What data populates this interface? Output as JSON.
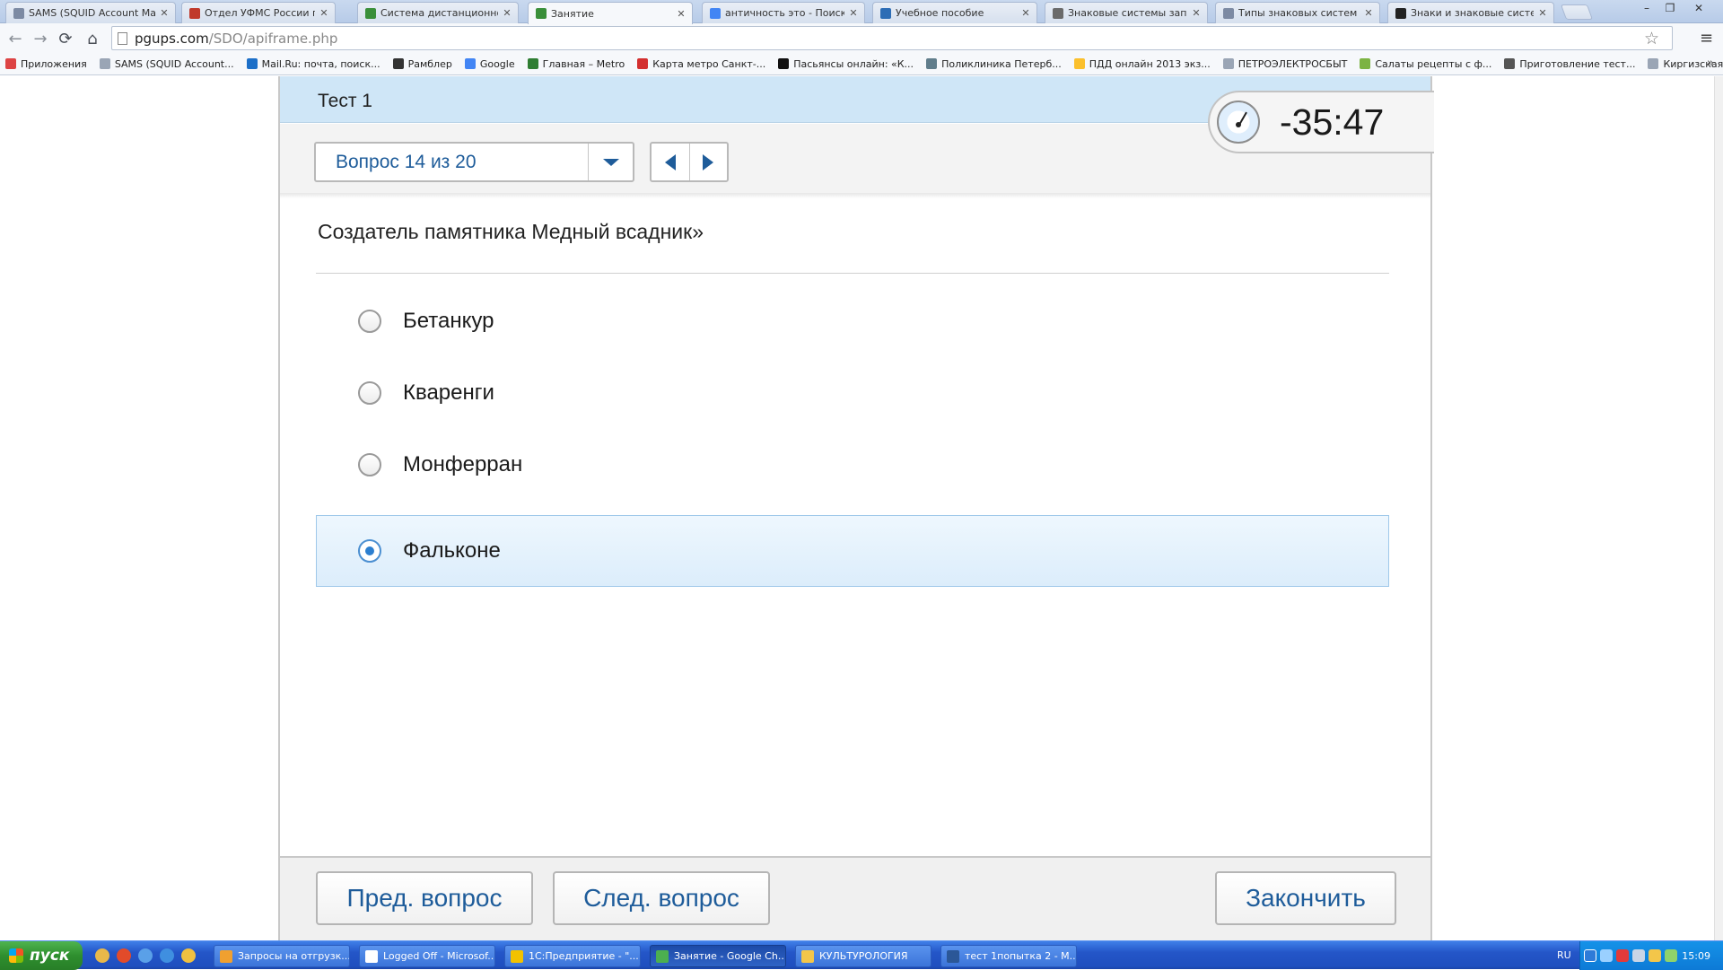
{
  "browser": {
    "tabs": [
      {
        "title": "SAMS (SQUID Account Mana",
        "icon_color": "#7c8aa3"
      },
      {
        "title": "Отдел УФМС России по Сан",
        "icon_color": "#c0392b"
      },
      {
        "title": "Система дистанционного о",
        "icon_color": "#3a8f3a"
      },
      {
        "title": "Занятие",
        "icon_color": "#3a8f3a"
      },
      {
        "title": "античность это - Поиск в G",
        "icon_color": "#4285f4"
      },
      {
        "title": "Учебное пособие",
        "icon_color": "#2d6db5"
      },
      {
        "title": "Знаковые системы записи -",
        "icon_color": "#6a6a6a"
      },
      {
        "title": "Типы знаковых систем и их",
        "icon_color": "#7c8aa3"
      },
      {
        "title": "Знаки и знаковые системы",
        "icon_color": "#222222"
      }
    ],
    "window_controls": [
      "–",
      "❐",
      "✕"
    ],
    "nav_icons": {
      "back": "←",
      "forward": "→",
      "reload": "⟳",
      "home": "⌂"
    },
    "address": {
      "host": "pgups.com",
      "path": "/SDO/apiframe.php"
    },
    "star_icon": "☆",
    "menu_icon": "≡",
    "bookmarks": [
      {
        "label": "Приложения",
        "icon_color": "#d44"
      },
      {
        "label": "SAMS (SQUID Account...",
        "icon_color": "#9aa5b5"
      },
      {
        "label": "Mail.Ru: почта, поиск...",
        "icon_color": "#1c6fc8"
      },
      {
        "label": "Рамблер",
        "icon_color": "#333333"
      },
      {
        "label": "Google",
        "icon_color": "#4285f4"
      },
      {
        "label": "Главная – Metro",
        "icon_color": "#2e7d32"
      },
      {
        "label": "Карта метро Санкт-...",
        "icon_color": "#d32f2f"
      },
      {
        "label": "Пасьянсы онлайн: «К...",
        "icon_color": "#111111"
      },
      {
        "label": "Поликлиника Петерб...",
        "icon_color": "#607d8b"
      },
      {
        "label": "ПДД онлайн 2013 экз...",
        "icon_color": "#fbc02d"
      },
      {
        "label": "ПЕТРОЭЛЕКТРОСБЫТ",
        "icon_color": "#9aa5b5"
      },
      {
        "label": "Салаты рецепты с ф...",
        "icon_color": "#7cb342"
      },
      {
        "label": "Приготовление тест...",
        "icon_color": "#555555"
      },
      {
        "label": "Киргизская кухня",
        "icon_color": "#9aa5b5"
      }
    ],
    "bookmarks_more": "»"
  },
  "test": {
    "title": "Тест 1",
    "question_selector": "Вопрос 14 из 20",
    "timer": "-35:47",
    "question": "Создатель памятника Медный всадник»",
    "answers": [
      "Бетанкур",
      "Кваренги",
      "Монферран",
      "Фальконе"
    ],
    "selected_answer": "Фальконе",
    "buttons": {
      "prev": "Пред. вопрос",
      "next": "След. вопрос",
      "finish": "Закончить"
    },
    "accent_color": "#1e5c9a"
  },
  "taskbar": {
    "start": "пуск",
    "tasks": [
      {
        "title": "Запросы на отгрузк...",
        "icon_color": "#f0a030"
      },
      {
        "title": "Logged Off - Microsof...",
        "icon_color": "#ffffff"
      },
      {
        "title": "1С:Предприятие - \"...",
        "icon_color": "#f2c200"
      },
      {
        "title": "Занятие - Google Ch...",
        "icon_color": "#4caf50"
      },
      {
        "title": "КУЛЬТУРОЛОГИЯ",
        "icon_color": "#f3c64a"
      },
      {
        "title": "тест 1попытка 2 - M...",
        "icon_color": "#2b5797"
      }
    ],
    "language": "RU",
    "clock": "15:09"
  }
}
